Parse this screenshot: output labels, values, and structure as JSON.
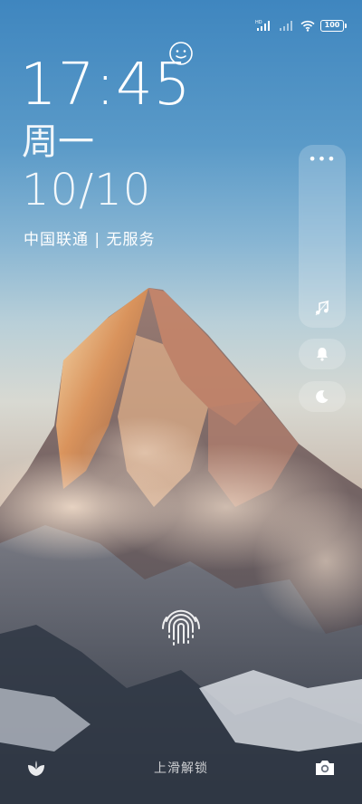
{
  "status_bar": {
    "hd_label": "HD",
    "battery_level": "100"
  },
  "lock_screen": {
    "time": "17:45",
    "weekday": "周一",
    "date": "10/10",
    "carrier": "中国联通 | 无服务"
  },
  "controls": {
    "more_label": "•••",
    "items": [
      "music-icon",
      "bell-icon",
      "moon-icon"
    ]
  },
  "bottom": {
    "swipe_hint": "上滑解锁",
    "left_icon": "leaf-icon",
    "right_icon": "camera-icon"
  }
}
